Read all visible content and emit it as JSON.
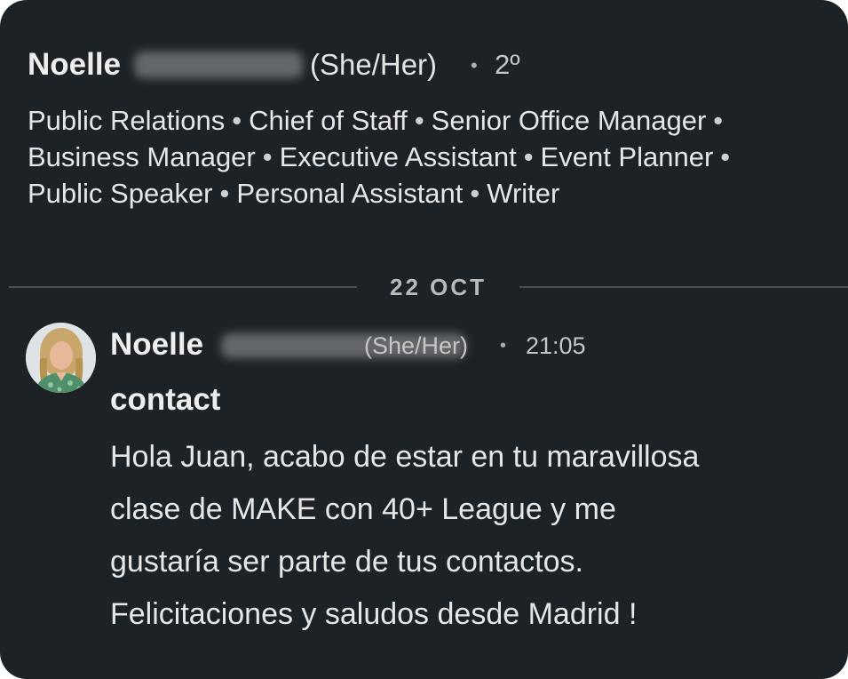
{
  "profile": {
    "name": "Noelle",
    "pronouns": "(She/Her)",
    "separator": "•",
    "degree": "2º",
    "headline_lines": [
      [
        "Public Relations",
        "Chief of Staff",
        "Senior Office Manager",
        ""
      ],
      [
        "Business Manager",
        "Executive Assistant",
        "Event Planner",
        ""
      ],
      [
        "Public Speaker",
        "Personal Assistant",
        "Writer"
      ]
    ]
  },
  "date_divider": {
    "label": "22 OCT"
  },
  "message": {
    "sender_name": "Noelle",
    "pronouns": "(She/Her)",
    "separator": "•",
    "time": "21:05",
    "subject": "contact",
    "body_lines": [
      "Hola Juan, acabo de estar en tu maravillosa",
      "clase de MAKE con 40+ League y me",
      "gustaría ser parte de tus contactos.",
      "Felicitaciones y saludos desde Madrid !"
    ]
  },
  "colors": {
    "background": "#1d2226",
    "text_primary": "#eeeeee",
    "text_secondary": "#c5c5c5",
    "divider": "#4a4f53"
  }
}
